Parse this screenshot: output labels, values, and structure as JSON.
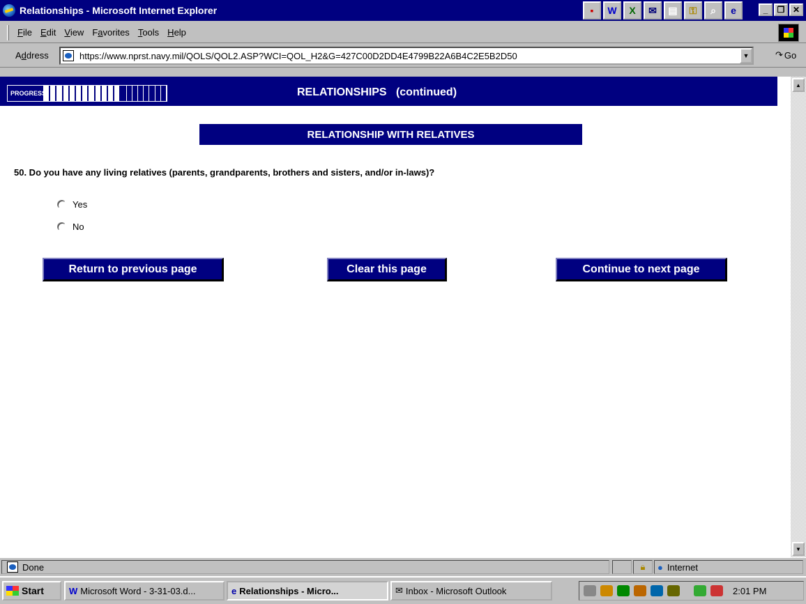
{
  "window": {
    "title": "Relationships - Microsoft Internet Explorer"
  },
  "menu": {
    "items": [
      {
        "pre": "",
        "key": "F",
        "post": "ile"
      },
      {
        "pre": "",
        "key": "E",
        "post": "dit"
      },
      {
        "pre": "",
        "key": "V",
        "post": "iew"
      },
      {
        "pre": "F",
        "key": "a",
        "post": "vorites"
      },
      {
        "pre": "",
        "key": "T",
        "post": "ools"
      },
      {
        "pre": "",
        "key": "H",
        "post": "elp"
      }
    ]
  },
  "address": {
    "label_pre": "A",
    "label_key": "d",
    "label_post": "dress",
    "url": "https://www.nprst.navy.mil/QOLS/QOL2.ASP?WCI=QOL_H2&G=427C00D2DD4E4799B22A6B4C2E5B2D50",
    "go": "Go"
  },
  "banner": {
    "progress_label": "PROGRESS:",
    "progress_fraction": 0.6,
    "title": "RELATIONSHIPS   (continued)"
  },
  "section": {
    "header": "RELATIONSHIP WITH RELATIVES"
  },
  "question": {
    "text": "50. Do you have any living relatives (parents, grandparents, brothers and sisters, and/or in-laws)?",
    "options": [
      "Yes",
      "No"
    ]
  },
  "buttons": {
    "previous": "Return to previous page",
    "clear": "Clear this page",
    "next": "Continue to next page"
  },
  "status": {
    "text": "Done",
    "zone": "Internet"
  },
  "taskbar": {
    "start": "Start",
    "tasks": [
      "Microsoft Word - 3-31-03.d...",
      "Relationships - Micro...",
      "Inbox - Microsoft Outlook"
    ],
    "clock": "2:01 PM"
  },
  "colors": {
    "navy": "#000080",
    "chrome": "#c0c0c0"
  }
}
